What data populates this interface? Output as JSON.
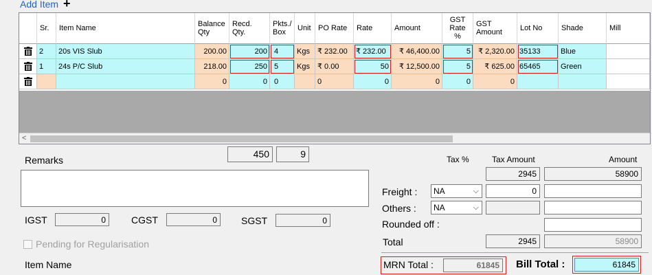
{
  "toolbar": {
    "add_item_label": "Add Item",
    "plus_icon": "+"
  },
  "grid": {
    "headers": {
      "sr": "Sr.",
      "item_name": "Item Name",
      "balance_qty": "Balance Qty",
      "recd_qty": "Recd. Qty.",
      "pkts_box": "Pkts./ Box",
      "unit": "Unit",
      "po_rate": "PO Rate",
      "rate": "Rate",
      "amount": "Amount",
      "gst_rate": "GST Rate %",
      "gst_amount": "GST Amount",
      "lot_no": "Lot No",
      "shade": "Shade",
      "mill": "Mill"
    },
    "rows": [
      {
        "sr": "2",
        "item_name": "20s VIS Slub",
        "balance_qty": "200.00",
        "recd_qty": "200",
        "pkts_box": "4",
        "unit": "Kgs",
        "po_rate": "₹ 232.00",
        "rate": "₹ 232.00",
        "amount": "₹ 46,400.00",
        "gst_rate": "5",
        "gst_amount": "₹ 2,320.00",
        "lot_no": "35133",
        "shade": "Blue",
        "mill": ""
      },
      {
        "sr": "1",
        "item_name": "24s P/C Slub",
        "balance_qty": "218.00",
        "recd_qty": "250",
        "pkts_box": "5",
        "unit": "Kgs",
        "po_rate": "₹ 0.00",
        "rate": "50",
        "amount": "₹ 12,500.00",
        "gst_rate": "5",
        "gst_amount": "₹ 625.00",
        "lot_no": "65465",
        "shade": "Green",
        "mill": ""
      },
      {
        "sr": "",
        "item_name": "",
        "balance_qty": "0",
        "recd_qty": "0",
        "pkts_box": "0",
        "unit": "",
        "po_rate": "0",
        "rate": "0",
        "amount": "0",
        "gst_rate": "0",
        "gst_amount": "0",
        "lot_no": "",
        "shade": "",
        "mill": ""
      }
    ],
    "scroll_left": "<"
  },
  "totals_row": {
    "qty_total": "450",
    "pkts_total": "9"
  },
  "remarks": {
    "label": "Remarks",
    "value": ""
  },
  "gst": {
    "igst_label": "IGST",
    "igst_value": "0",
    "cgst_label": "CGST",
    "cgst_value": "0",
    "sgst_label": "SGST",
    "sgst_value": "0"
  },
  "pending": {
    "label": "Pending for Regularisation"
  },
  "footer": {
    "item_name_label": "Item Name"
  },
  "summary": {
    "tax_pct_header": "Tax %",
    "tax_amount_header": "Tax Amount",
    "amount_header": "Amount",
    "tax_amount": "2945",
    "amount": "58900",
    "freight_label": "Freight :",
    "freight_select": "NA",
    "freight_tax": "0",
    "freight_amount": "",
    "others_label": "Others :",
    "others_select": "NA",
    "others_tax": "",
    "others_amount": "",
    "rounded_label": "Rounded off :",
    "rounded_value": "",
    "total_label": "Total",
    "total_tax": "2945",
    "total_amount": "58900",
    "mrn_label": "MRN Total :",
    "mrn_value": "61845",
    "bill_label": "Bill Total :",
    "bill_value": "61845"
  }
}
